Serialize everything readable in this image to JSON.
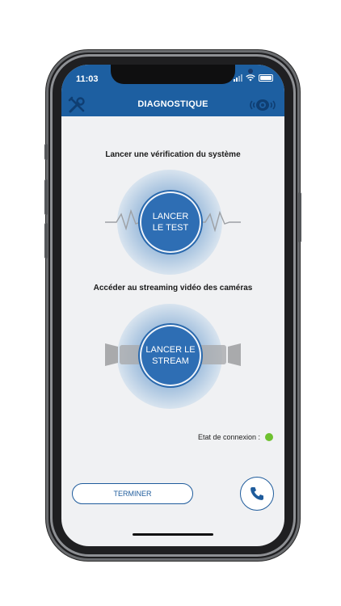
{
  "status_bar": {
    "time": "11:03"
  },
  "header": {
    "title": "DIAGNOSTIQUE"
  },
  "test_section": {
    "label": "Lancer une vérification du système",
    "button_line1": "LANCER",
    "button_line2": "LE TEST"
  },
  "stream_section": {
    "label": "Accéder au streaming vidéo des caméras",
    "button_line1": "LANCER LE",
    "button_line2": "STREAM"
  },
  "connection": {
    "label": "Etat de connexion :",
    "status_color": "#6ec12f"
  },
  "footer": {
    "finish_label": "TERMINER"
  },
  "colors": {
    "primary": "#1d5fa1",
    "background": "#f0f1f3"
  }
}
